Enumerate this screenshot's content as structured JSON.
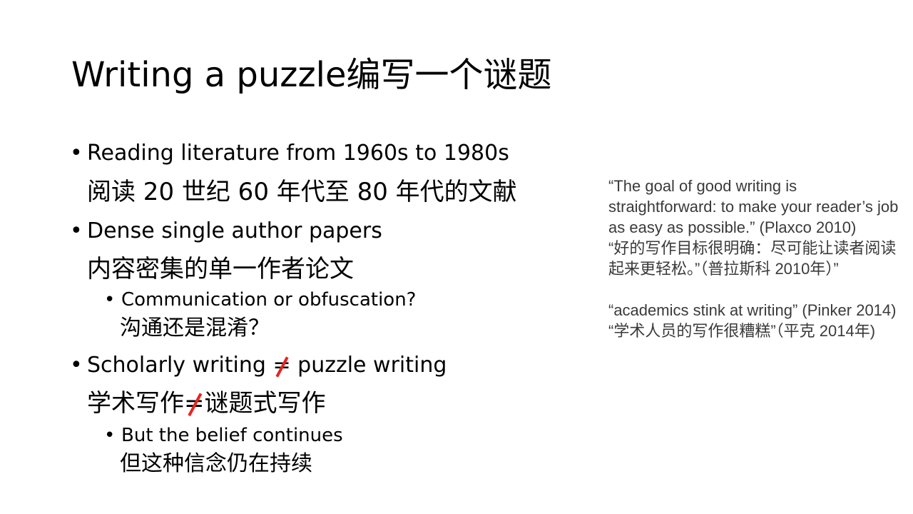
{
  "slide": {
    "title": "Writing a puzzle编写一个谜题",
    "bullets": {
      "b1_en": "Reading literature from 1960s to 1980s",
      "b1_cn": "阅读 20 世纪 60 年代至 80 年代的文献",
      "b2_en": "Dense single author papers",
      "b2_cn": "内容密集的单一作者论文",
      "b2_sub_en": "Communication or obfuscation?",
      "b2_sub_cn": "沟通还是混淆？",
      "b3_en_pre": "Scholarly writing ",
      "b3_en_sym": "=",
      "b3_en_post": " puzzle writing",
      "b3_cn_pre": "学术写作",
      "b3_cn_sym": "=",
      "b3_cn_post": "谜题式写作",
      "b3_sub_en": "But the belief continues",
      "b3_sub_cn": "但这种信念仍在持续"
    },
    "bullet_glyph": "•",
    "quotes": {
      "q1_en": "“The goal of good writing is straightforward: to make your reader’s job as easy as possible.” (Plaxco 2010)",
      "q1_cn": "“好的写作目标很明确：尽可能让读者阅读起来更轻松。”（普拉斯科 2010年）”",
      "q2_en": "“academics stink at writing” (Pinker 2014)",
      "q2_cn": "“学术人员的写作很糟糕”（平克 2014年)"
    },
    "colors": {
      "text": "#000000",
      "quote_text": "#3a3a3a",
      "strike": "#e8231f",
      "background": "#ffffff"
    }
  }
}
